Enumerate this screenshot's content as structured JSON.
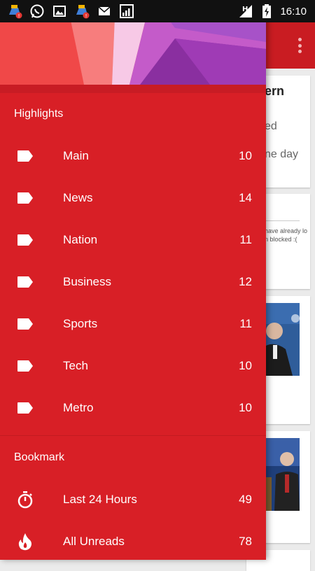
{
  "status_bar": {
    "time": "16:10",
    "network_label": "H",
    "left_icons": [
      "cleaner-alert-icon",
      "whatsapp-icon",
      "image-icon",
      "cleaner-alert-icon",
      "email-icon",
      "signal-chart-icon"
    ],
    "right_icons": [
      "signal-icon",
      "battery-charging-icon"
    ]
  },
  "drawer": {
    "sections": [
      {
        "title": "Highlights",
        "items": [
          {
            "label": "Main",
            "count": "10",
            "icon": "label-icon"
          },
          {
            "label": "News",
            "count": "14",
            "icon": "label-icon"
          },
          {
            "label": "Nation",
            "count": "11",
            "icon": "label-icon"
          },
          {
            "label": "Business",
            "count": "12",
            "icon": "label-icon"
          },
          {
            "label": "Sports",
            "count": "11",
            "icon": "label-icon"
          },
          {
            "label": "Tech",
            "count": "10",
            "icon": "label-icon"
          },
          {
            "label": "Metro",
            "count": "10",
            "icon": "label-icon"
          }
        ]
      },
      {
        "title": "Bookmark",
        "items": [
          {
            "label": "Last 24 Hours",
            "count": "49",
            "icon": "stopwatch-icon"
          },
          {
            "label": "All Unreads",
            "count": "78",
            "icon": "flame-icon"
          }
        ]
      }
    ]
  },
  "background": {
    "card1": {
      "title": "ern",
      "line1": "ed",
      "line2": "ne day"
    },
    "card2": {
      "line1": "have already lo",
      "line2": "n blocked :("
    }
  },
  "colors": {
    "drawer": "#d81f26",
    "app_bar": "#c91c22",
    "status_bar": "#111111"
  }
}
